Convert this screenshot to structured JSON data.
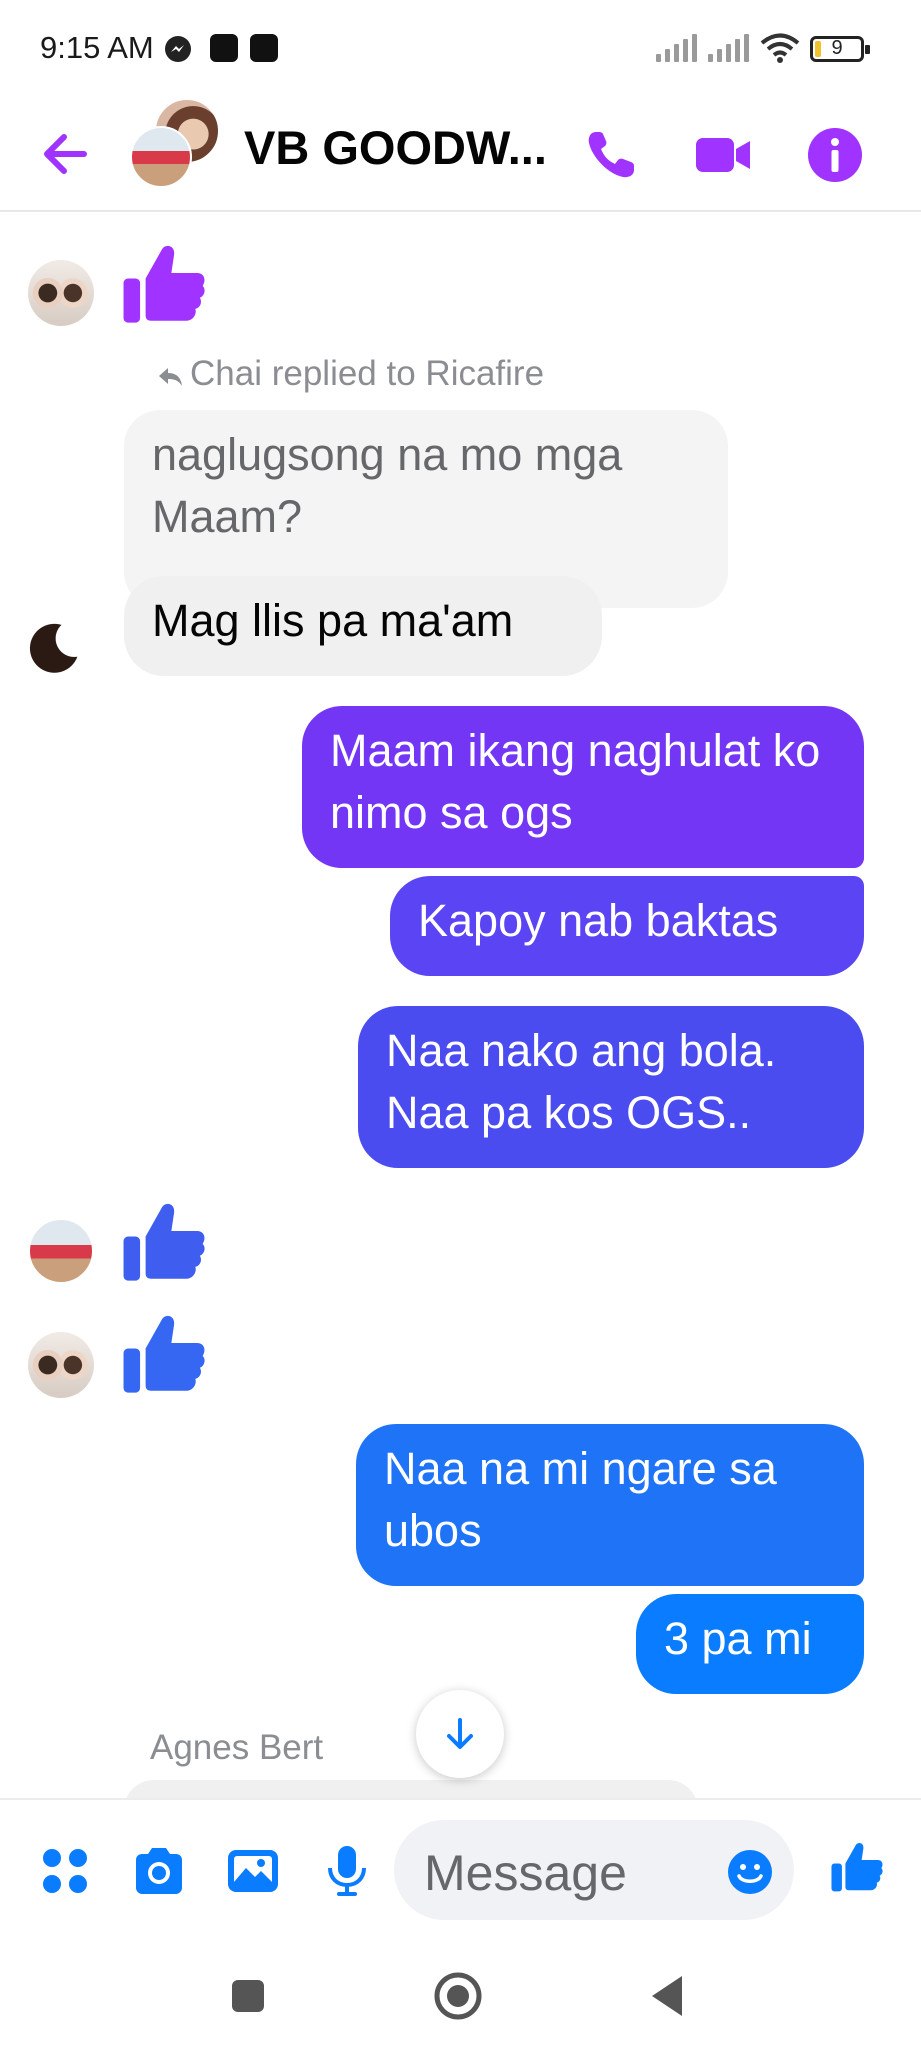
{
  "status_bar": {
    "time": "9:15 AM",
    "battery": "9",
    "icons": [
      "messenger-icon",
      "notification-square-icon",
      "notification-square-icon",
      "signal-icon",
      "signal-icon",
      "wifi-icon",
      "battery-icon"
    ]
  },
  "header": {
    "contact_name": "VB GOODW...",
    "icons": [
      "back-arrow-icon",
      "phone-icon",
      "video-icon",
      "info-icon"
    ],
    "accent_color": "#a033ff"
  },
  "messages": {
    "reply_label": "Chai replied to Ricafire",
    "quoted": "naglugsong na mo mga Maam?",
    "reply": "Mag llis pa ma'am",
    "out_1": "Maam ikang naghulat ko nimo sa ogs",
    "out_2": "Kapoy nab baktas",
    "out_3": "Naa nako ang bola. Naa pa kos OGS..",
    "out_4": "Naa na mi ngare sa ubos",
    "out_5": "3 pa mi",
    "sender_label": "Agnes Bert",
    "colors": [
      "#8a2cf5",
      "#7336f5",
      "#5b44f3",
      "#4a4cf0",
      "#1f73f6",
      "#0a7cff"
    ]
  },
  "composer": {
    "placeholder": "Message",
    "icons": [
      "apps-icon",
      "camera-icon",
      "gallery-icon",
      "microphone-icon",
      "emoji-icon",
      "like-icon"
    ],
    "accent_color": "#0a7cff"
  },
  "nav_bar": {
    "icons": [
      "recents-square-icon",
      "home-circle-icon",
      "back-triangle-icon"
    ]
  }
}
